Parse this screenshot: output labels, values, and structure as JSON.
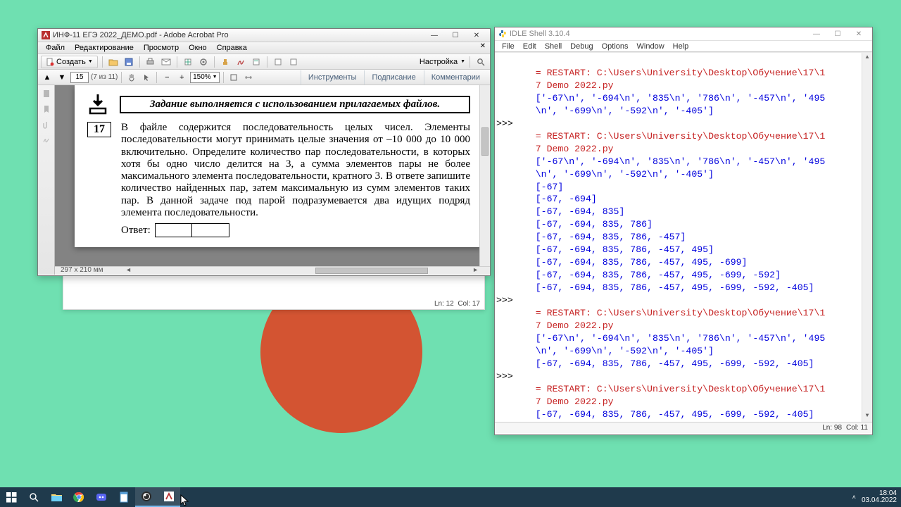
{
  "acrobat": {
    "title": "ИНФ-11 ЕГЭ 2022_ДЕМО.pdf - Adobe Acrobat Pro",
    "menu": [
      "Файл",
      "Редактирование",
      "Просмотр",
      "Окно",
      "Справка"
    ],
    "create_label": "Создать",
    "settings_label": "Настройка",
    "page_num": "15",
    "page_of": "(7 из 11)",
    "zoom": "150%",
    "panels": [
      "Инструменты",
      "Подписание",
      "Комментарии"
    ],
    "doc_size": "297 x 210 мм",
    "task_title": "Задание выполняется с использованием прилагаемых файлов.",
    "task_number": "17",
    "task_text": "В   файле   содержится   последовательность   целых   чисел.   Элементы последовательности могут принимать целые значения от –10 000 до 10 000 включительно. Определите количество пар последовательности, в которых хотя бы одно число делится на 3, а сумма элементов пары не более максимального элемента последовательности, кратного 3. В ответе запишите количество найденных пар, затем максимальную из сумм элементов таких пар. В данной задаче под парой подразумевается два идущих подряд элемента последовательности.",
    "answer_label": "Ответ:"
  },
  "slide": {
    "status_ln": "Ln: 12",
    "status_col": "Col: 17"
  },
  "idle": {
    "title": "IDLE Shell 3.10.4",
    "menu": [
      "File",
      "Edit",
      "Shell",
      "Debug",
      "Options",
      "Window",
      "Help"
    ],
    "restart1a": "= RESTART: C:\\Users\\University\\Desktop\\Обучение\\17\\1",
    "restart1b": "7 Demo 2022.py",
    "list_raw1": "['-67\\n', '-694\\n', '835\\n', '786\\n', '-457\\n', '495",
    "list_raw2": "\\n', '-699\\n', '-592\\n', '-405']",
    "a1": "[-67]",
    "a2": "[-67, -694]",
    "a3": "[-67, -694, 835]",
    "a4": "[-67, -694, 835, 786]",
    "a5": "[-67, -694, 835, 786, -457]",
    "a6": "[-67, -694, 835, 786, -457, 495]",
    "a7": "[-67, -694, 835, 786, -457, 495, -699]",
    "a8": "[-67, -694, 835, 786, -457, 495, -699, -592]",
    "a9": "[-67, -694, 835, 786, -457, 495, -699, -592, -405]",
    "prompt": ">>>",
    "status_ln": "Ln: 98",
    "status_col": "Col: 11"
  },
  "taskbar": {
    "time": "18:04",
    "date": "03.04.2022"
  }
}
